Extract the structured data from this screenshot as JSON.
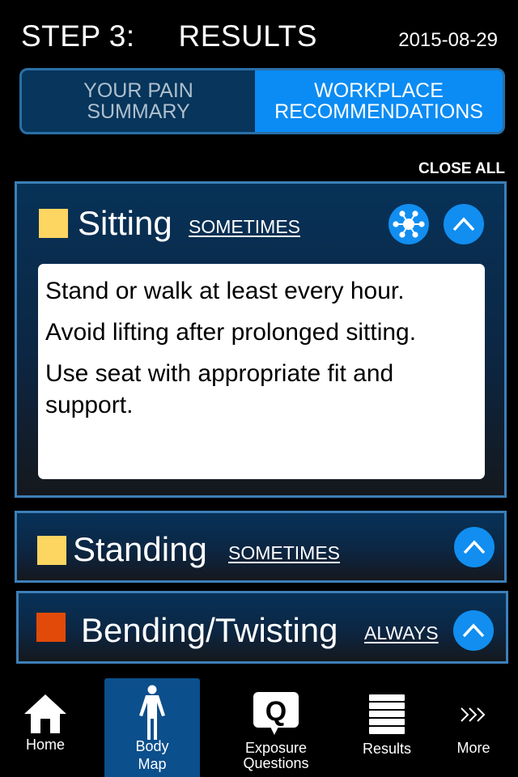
{
  "header": {
    "title": "STEP 3:     RESULTS",
    "date": "2015-08-29"
  },
  "segmented": {
    "left_label": "YOUR PAIN SUMMARY",
    "left_line1": "YOUR PAIN",
    "left_line2": "SUMMARY",
    "right_line1": "WORKPLACE",
    "right_line2": "RECOMMENDATIONS",
    "selected": "WORKPLACE RECOMMENDATIONS"
  },
  "close_all_label": "CLOSE ALL",
  "panels": [
    {
      "title": "Sitting",
      "frequency": "SOMETIMES",
      "swatch_color": "#fdd561",
      "expanded": true,
      "recommendations": [
        "Stand or walk at least every hour.",
        "Avoid lifting after prolonged sitting.",
        "Use seat with appropriate fit and support."
      ]
    },
    {
      "title": "Standing",
      "frequency": "SOMETIMES",
      "swatch_color": "#fdd561",
      "expanded": false
    },
    {
      "title": "Bending/Twisting",
      "frequency": "ALWAYS",
      "swatch_color": "#e14a09",
      "expanded": false
    }
  ],
  "icons": {
    "network": "network-hub-icon",
    "collapse": "chevron-up-icon"
  },
  "tabbar": {
    "items": [
      {
        "label_line1": "Home",
        "label_line2": "",
        "icon": "home-icon"
      },
      {
        "label_line1": "Body",
        "label_line2": "Map",
        "icon": "body-figure-icon",
        "selected": true
      },
      {
        "label_line1": "Exposure",
        "label_line2": "Questions",
        "icon": "question-bubble-icon"
      },
      {
        "label_line1": "Results",
        "label_line2": "",
        "icon": "stack-list-icon"
      },
      {
        "label_line1": "More",
        "label_line2": "",
        "icon": "triple-chevron-icon"
      }
    ]
  }
}
